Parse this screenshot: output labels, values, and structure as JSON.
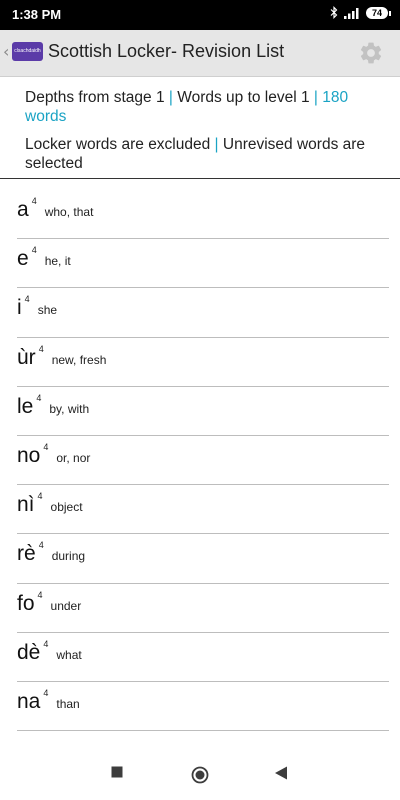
{
  "status": {
    "time": "1:38 PM",
    "battery": "74"
  },
  "header": {
    "title": "Scottish Locker- Revision List",
    "logo_text": "clsachdaidh"
  },
  "info": {
    "depth": "Depths from stage 1",
    "sep1": " | ",
    "level": "Words up to level 1",
    "sep2": " | ",
    "count": "180 words",
    "locker": "Locker words are excluded",
    "sep3": " | ",
    "unrevised": "Unrevised words are selected"
  },
  "words": [
    {
      "word": "a",
      "level": "4",
      "meaning": "who, that"
    },
    {
      "word": "e",
      "level": "4",
      "meaning": "he, it"
    },
    {
      "word": "i",
      "level": "4",
      "meaning": "she"
    },
    {
      "word": "ùr",
      "level": "4",
      "meaning": "new, fresh"
    },
    {
      "word": "le",
      "level": "4",
      "meaning": "by, with"
    },
    {
      "word": "no",
      "level": "4",
      "meaning": "or, nor"
    },
    {
      "word": "nì",
      "level": "4",
      "meaning": "object"
    },
    {
      "word": "rè",
      "level": "4",
      "meaning": "during"
    },
    {
      "word": "fo",
      "level": "4",
      "meaning": "under"
    },
    {
      "word": "dè",
      "level": "4",
      "meaning": "what"
    },
    {
      "word": "na",
      "level": "4",
      "meaning": "than"
    }
  ],
  "icons": {
    "back": "chevron-left-icon",
    "settings": "gear-icon",
    "nav_recents": "square-icon",
    "nav_home": "circle-icon",
    "nav_back": "triangle-left-icon"
  },
  "colors": {
    "accent": "#1aa3c4",
    "logo": "#5b3ba8",
    "app_bar": "#e6e6e6"
  }
}
